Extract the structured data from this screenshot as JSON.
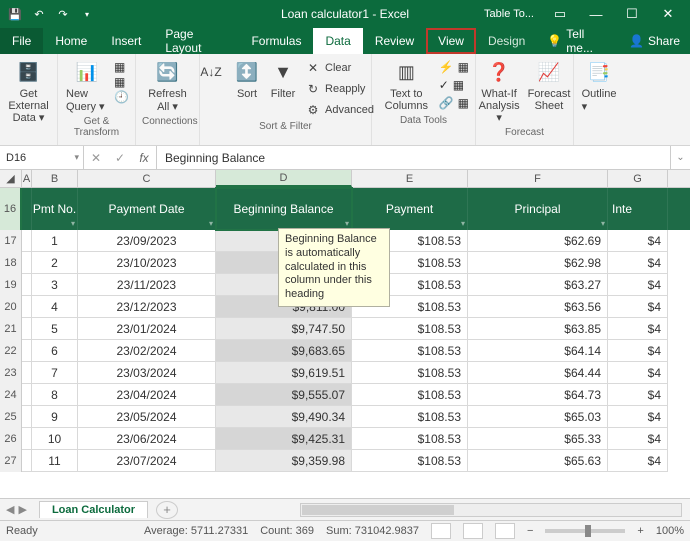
{
  "title": "Loan calculator1 - Excel",
  "table_tools": "Table To...",
  "menu": {
    "file": "File",
    "home": "Home",
    "insert": "Insert",
    "page_layout": "Page Layout",
    "formulas": "Formulas",
    "data": "Data",
    "review": "Review",
    "view": "View",
    "design": "Design",
    "tell_me": "Tell me...",
    "share": "Share"
  },
  "ribbon": {
    "get_external": "Get External Data ▾",
    "new_query": "New Query ▾",
    "get_transform": "Get & Transform",
    "refresh_all": "Refresh All ▾",
    "connections": "Connections",
    "sort": "Sort",
    "filter": "Filter",
    "clear": "Clear",
    "reapply": "Reapply",
    "advanced": "Advanced",
    "sort_filter": "Sort & Filter",
    "text_to_columns": "Text to Columns",
    "data_tools": "Data Tools",
    "what_if": "What-If Analysis ▾",
    "forecast_sheet": "Forecast Sheet",
    "forecast": "Forecast",
    "outline": "Outline ▾"
  },
  "namebox": "D16",
  "formula": "Beginning Balance",
  "cols": {
    "A": "A",
    "B": "B",
    "C": "C",
    "D": "D",
    "E": "E",
    "F": "F",
    "G": "G"
  },
  "headers": {
    "pmt_no": "Pmt No.",
    "payment_date": "Payment Date",
    "beginning_balance": "Beginning Balance",
    "payment": "Payment",
    "principal": "Principal",
    "interest": "Inte"
  },
  "tooltip": "Beginning Balance is automatically calculated in this column under this heading",
  "rows": [
    {
      "r": 17,
      "no": "1",
      "date": "23/09/2023",
      "bal": "$1",
      "pay": "$108.53",
      "prin": "$62.69",
      "int": "$4"
    },
    {
      "r": 18,
      "no": "2",
      "date": "23/10/2023",
      "bal": "$",
      "pay": "$108.53",
      "prin": "$62.98",
      "int": "$4"
    },
    {
      "r": 19,
      "no": "3",
      "date": "23/11/2023",
      "bal": "$",
      "pay": "$108.53",
      "prin": "$63.27",
      "int": "$4"
    },
    {
      "r": 20,
      "no": "4",
      "date": "23/12/2023",
      "bal": "$9,811.00",
      "pay": "$108.53",
      "prin": "$63.56",
      "int": "$4"
    },
    {
      "r": 21,
      "no": "5",
      "date": "23/01/2024",
      "bal": "$9,747.50",
      "pay": "$108.53",
      "prin": "$63.85",
      "int": "$4"
    },
    {
      "r": 22,
      "no": "6",
      "date": "23/02/2024",
      "bal": "$9,683.65",
      "pay": "$108.53",
      "prin": "$64.14",
      "int": "$4"
    },
    {
      "r": 23,
      "no": "7",
      "date": "23/03/2024",
      "bal": "$9,619.51",
      "pay": "$108.53",
      "prin": "$64.44",
      "int": "$4"
    },
    {
      "r": 24,
      "no": "8",
      "date": "23/04/2024",
      "bal": "$9,555.07",
      "pay": "$108.53",
      "prin": "$64.73",
      "int": "$4"
    },
    {
      "r": 25,
      "no": "9",
      "date": "23/05/2024",
      "bal": "$9,490.34",
      "pay": "$108.53",
      "prin": "$65.03",
      "int": "$4"
    },
    {
      "r": 26,
      "no": "10",
      "date": "23/06/2024",
      "bal": "$9,425.31",
      "pay": "$108.53",
      "prin": "$65.33",
      "int": "$4"
    },
    {
      "r": 27,
      "no": "11",
      "date": "23/07/2024",
      "bal": "$9,359.98",
      "pay": "$108.53",
      "prin": "$65.63",
      "int": "$4"
    }
  ],
  "sheet_tab": "Loan Calculator",
  "status": {
    "ready": "Ready",
    "average": "Average: 5711.27331",
    "count": "Count: 369",
    "sum": "Sum: 731042.9837",
    "zoom": "100%"
  }
}
